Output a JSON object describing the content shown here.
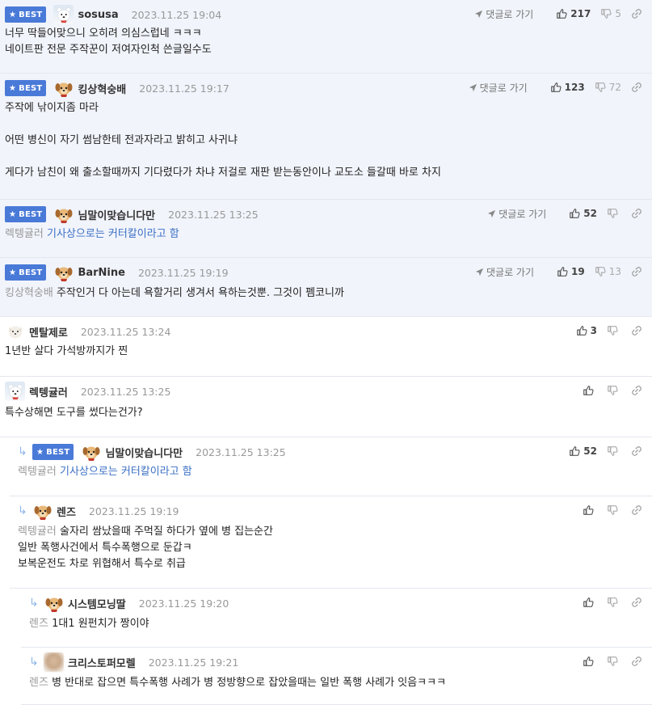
{
  "ui": {
    "best_label": "BEST",
    "goto_label": "댓글로 가기"
  },
  "comments": [
    {
      "best": true,
      "avatar": "bear-icon",
      "nick": "sosusa",
      "date": "2023.11.25 19:04",
      "up": "217",
      "down": "5",
      "lines": [
        "너무 딱들어맞으니 오히려 의심스럽네 ㅋㅋㅋ",
        "네이트판 전문 주작꾼이 저여자인척 쓴글일수도"
      ]
    },
    {
      "best": true,
      "avatar": "dog-icon",
      "nick": "킹상혁숭배",
      "date": "2023.11.25 19:17",
      "up": "123",
      "down": "72",
      "lines": [
        "주작에 낚이지좀 마라",
        "",
        "어떤 병신이 자기 썸남한테 전과자라고 밝히고 사귀냐",
        "",
        "게다가 남친이 왜 출소할때까지 기다렸다가 차냐 저걸로 재판 받는동안이나 교도소 들갈때 바로 차지"
      ]
    },
    {
      "best": true,
      "avatar": "dog-icon",
      "nick": "님말이맞습니다만",
      "date": "2023.11.25 13:25",
      "up": "52",
      "down": "",
      "mention": "렉텡귤러",
      "link_text": "기사상으로는 커터칼이라고 함",
      "text": ""
    },
    {
      "best": true,
      "avatar": "dog-icon",
      "nick": "BarNine",
      "date": "2023.11.25 19:19",
      "up": "19",
      "down": "13",
      "mention": "킹상혁숭배",
      "text": "주작인거 다 아는데 욕할거리 생겨서 욕하는것뿐. 그것이 펨코니까"
    },
    {
      "best": false,
      "avatar": "dog-white-icon",
      "nick": "멘탈제로",
      "date": "2023.11.25 13:24",
      "up": "3",
      "down": "",
      "text": "1년반 살다 가석방까지가 찐"
    },
    {
      "best": false,
      "avatar": "bear-icon",
      "nick": "렉텡귤러",
      "date": "2023.11.25 13:25",
      "up": "",
      "down": "",
      "text": "특수상해면 도구를 썼다는건가?"
    },
    {
      "best": true,
      "reply": true,
      "avatar": "dog-icon",
      "nick": "님말이맞습니다만",
      "date": "2023.11.25 13:25",
      "up": "52",
      "down": "",
      "mention": "렉텡귤러",
      "link_text": "기사상으로는 커터칼이라고 함"
    },
    {
      "best": false,
      "reply": true,
      "avatar": "dog-icon",
      "nick": "렌즈",
      "date": "2023.11.25 19:19",
      "up": "",
      "down": "",
      "mention": "렉텡귤러",
      "text": "술자리 쌈났을때 주먹질 하다가 옆에 병 집는순간",
      "lines": [
        "일반 폭행사건에서 특수폭행으로 둔갑ㅋ",
        "보복운전도 차로 위협해서 특수로 취급"
      ]
    },
    {
      "best": false,
      "reply": true,
      "avatar": "dog-icon",
      "nick": "시스템모닝딸",
      "date": "2023.11.25 19:20",
      "up": "",
      "down": "",
      "mention": "렌즈",
      "text": "1대1 원펀치가 짱이야"
    },
    {
      "best": false,
      "reply": true,
      "avatar": "blur-avatar",
      "nick": "크리스토퍼모렐",
      "date": "2023.11.25 19:21",
      "up": "",
      "down": "",
      "mention": "렌즈",
      "text": "병 반대로 잡으면 특수폭행 사례가 병 정방향으로 잡았을때는 일반 폭행 사례가 잇음ㅋㅋㅋ"
    }
  ]
}
